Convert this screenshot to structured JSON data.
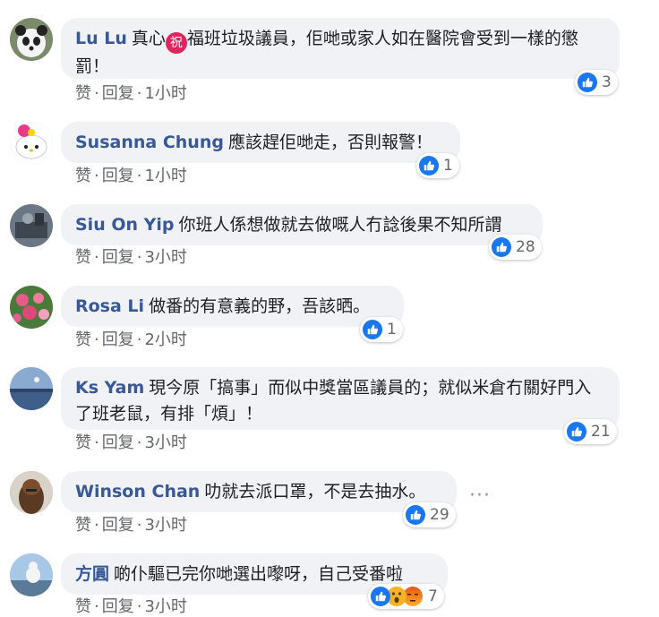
{
  "actions": {
    "like": "赞",
    "reply": "回复",
    "sep": "·"
  },
  "comments": [
    {
      "author": "Lu Lu",
      "pre": "真心",
      "emoji": "祝",
      "text": "福班垃圾議員，佢哋或家人如在醫院會受到一樣的懲罰！",
      "time": "1小时",
      "reactions": "3"
    },
    {
      "author": "Susanna Chung",
      "text": "應該趕佢哋走，否則報警！",
      "time": "1小时",
      "reactions": "1"
    },
    {
      "author": "Siu On Yip",
      "text": "你班人係想做就去做嘅人冇諗後果不知所謂",
      "time": "3小时",
      "reactions": "28"
    },
    {
      "author": "Rosa Li",
      "text": "做番的有意義的野，吾該晒。",
      "time": "2小时",
      "reactions": "1"
    },
    {
      "author": "Ks Yam",
      "text": "現今原「搞事」而似中獎當區議員的；就似米倉冇關好門入了班老鼠，有排「煩」！",
      "time": "3小时",
      "reactions": "21"
    },
    {
      "author": "Winson Chan",
      "text": "叻就去派口罩，不是去抽水。",
      "time": "3小时",
      "reactions": "29"
    },
    {
      "author": "方圓",
      "text": "啲仆驅已完你哋選出嚟呀，自己受番啦",
      "time": "3小时",
      "reactions": "7"
    }
  ],
  "more_options": "···",
  "icons": {
    "like": "thumbs-up-icon",
    "wow": "wow-face-icon",
    "angry": "angry-face-icon",
    "more": "more-options-icon"
  },
  "colors": {
    "author": "#385898",
    "like_blue": "#1877f2",
    "bubble": "#f0f2f5"
  }
}
